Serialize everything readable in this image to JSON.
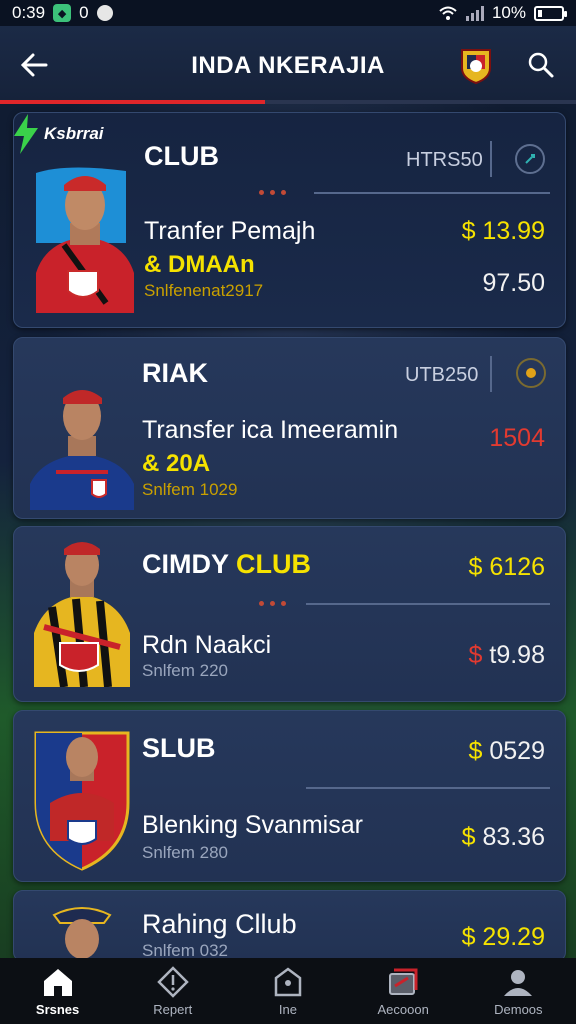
{
  "status": {
    "time": "0:39",
    "notif": "0",
    "battery": "10%"
  },
  "header": {
    "title": "INDA NKERAJIA",
    "progress": 0.46
  },
  "brand": {
    "label": "Ksbrrai"
  },
  "cards": [
    {
      "club": "CLUB",
      "club_accent": "",
      "code": "HTRS50",
      "name": "Tranfer Pemajh",
      "sub": "& DMAAn",
      "meta": "Snlfenenat2917",
      "price_top": "$ 13.99",
      "price_bottom": "97.50"
    },
    {
      "club": "RIAK",
      "club_accent": "",
      "code": "UTB250",
      "name": "Transfer ica Imeeramin",
      "sub": "& 20A",
      "meta": "Snlfem 1029",
      "price_top": "",
      "price_bottom": "1504"
    },
    {
      "club": "CIMDY",
      "club_accent": "CLUB",
      "code": "",
      "name": "Rdn Naakci",
      "sub": "",
      "meta": "Snlfem 220",
      "price_top": "$ 6126",
      "price_bottom": "$ t9.98"
    },
    {
      "club": "SLUB",
      "club_accent": "",
      "code": "",
      "name": "Blenking Svanmisar",
      "sub": "",
      "meta": "Snlfem 280",
      "price_top": "$ 0529",
      "price_bottom": "$ 83.36"
    },
    {
      "club": "Rahing Cllub",
      "club_accent": "",
      "code": "",
      "name": "",
      "sub": "",
      "meta": "Snlfem 032",
      "price_top": "$ 29.29",
      "price_bottom": ""
    }
  ],
  "nav": [
    {
      "label": "Srsnes",
      "icon": "home-icon"
    },
    {
      "label": "Repert",
      "icon": "diamond-icon"
    },
    {
      "label": "Ine",
      "icon": "tag-icon"
    },
    {
      "label": "Aecooon",
      "icon": "cards-icon"
    },
    {
      "label": "Demoos",
      "icon": "profile-icon"
    }
  ],
  "colors": {
    "accent_yellow": "#f5e200",
    "accent_red": "#e0262a",
    "card_bg": "#223253"
  }
}
